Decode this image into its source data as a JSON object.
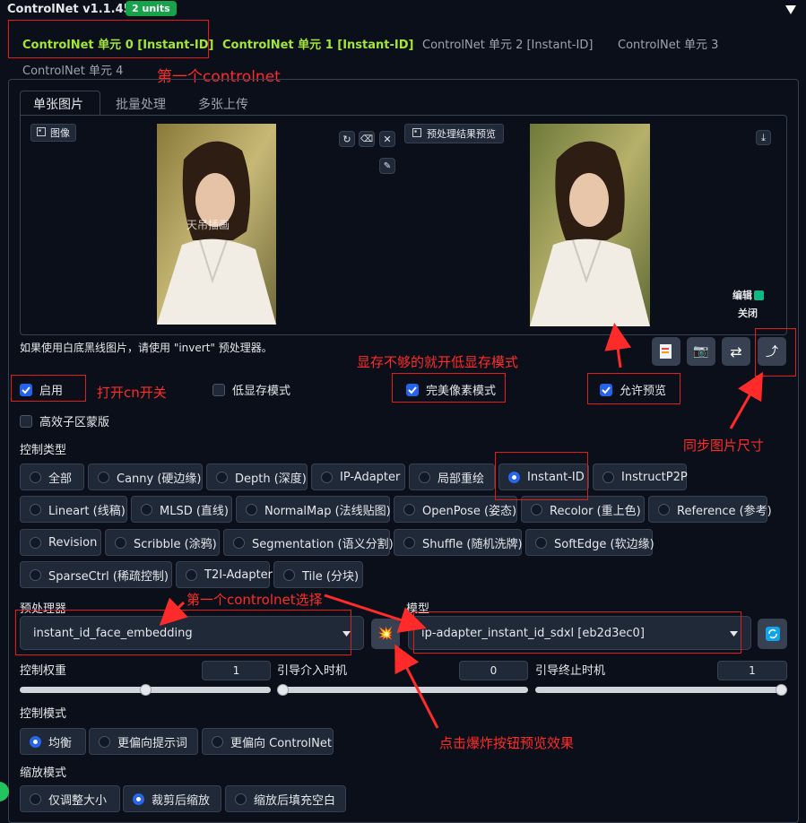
{
  "header": {
    "title": "ControlNet v1.1.455",
    "badge": "2 units",
    "collapse_icon": "triangle-down-icon"
  },
  "unit_tabs": [
    {
      "label": "ControlNet 单元 0 [Instant-ID]"
    },
    {
      "label": "ControlNet 单元 1 [Instant-ID]"
    },
    {
      "label": "ControlNet 单元 2 [Instant-ID]"
    },
    {
      "label": "ControlNet 单元 3"
    },
    {
      "label": "ControlNet 单元 4"
    }
  ],
  "image_tabs": [
    {
      "label": "单张图片"
    },
    {
      "label": "批量处理"
    },
    {
      "label": "多张上传"
    }
  ],
  "image_panel": {
    "input_label": "图像",
    "preview_label": "预处理结果预览",
    "watermark": "天吊插画",
    "edit_label": "编辑",
    "close_label": "关闭"
  },
  "hint": "如果使用白底黑线图片，请使用 \"invert\" 预处理器。",
  "checkboxes": {
    "enable": "启用",
    "lowvram": "低显存模式",
    "pixel_perfect": "完美像素模式",
    "allow_preview": "允许预览",
    "efficient_mask": "高效子区蒙版"
  },
  "control_type": {
    "label": "控制类型",
    "options": [
      "全部",
      "Canny (硬边缘)",
      "Depth (深度)",
      "IP-Adapter",
      "局部重绘",
      "Instant-ID",
      "InstructP2P",
      "Lineart (线稿)",
      "MLSD (直线)",
      "NormalMap (法线贴图)",
      "OpenPose (姿态)",
      "Recolor (重上色)",
      "Reference (参考)",
      "Revision",
      "Scribble (涂鸦)",
      "Segmentation (语义分割)",
      "Shuffle (随机洗牌)",
      "SoftEdge (软边缘)",
      "SparseCtrl (稀疏控制)",
      "T2I-Adapter",
      "Tile (分块)"
    ],
    "selected": "Instant-ID"
  },
  "preprocessor": {
    "label": "预处理器",
    "value": "instant_id_face_embedding"
  },
  "model": {
    "label": "模型",
    "value": "ip-adapter_instant_id_sdxl [eb2d3ec0]"
  },
  "sliders": {
    "weight": {
      "label": "控制权重",
      "value": "1",
      "fraction": 0.5
    },
    "start": {
      "label": "引导介入时机",
      "value": "0",
      "fraction": 0.0
    },
    "end": {
      "label": "引导终止时机",
      "value": "1",
      "fraction": 1.0
    }
  },
  "control_mode": {
    "label": "控制模式",
    "options": [
      "均衡",
      "更偏向提示词",
      "更偏向 ControlNet"
    ],
    "selected": "均衡"
  },
  "resize_mode": {
    "label": "缩放模式",
    "options": [
      "仅调整大小",
      "裁剪后缩放",
      "缩放后填充空白"
    ],
    "selected": "裁剪后缩放"
  },
  "annotations": {
    "first_controlnet": "第一个controlnet",
    "lowvram_hint": "显存不够的就开低显存模式",
    "enable_hint": "打开cn开关",
    "sync_size": "同步图片尺寸",
    "select_first": "第一个controlnet选择",
    "explode_hint": "点击爆炸按钮预览效果"
  },
  "colors": {
    "accent_green": "#a3e635",
    "brand_blue": "#2563eb",
    "annotation_red": "#ff2a2a",
    "background": "#0b0f19"
  }
}
